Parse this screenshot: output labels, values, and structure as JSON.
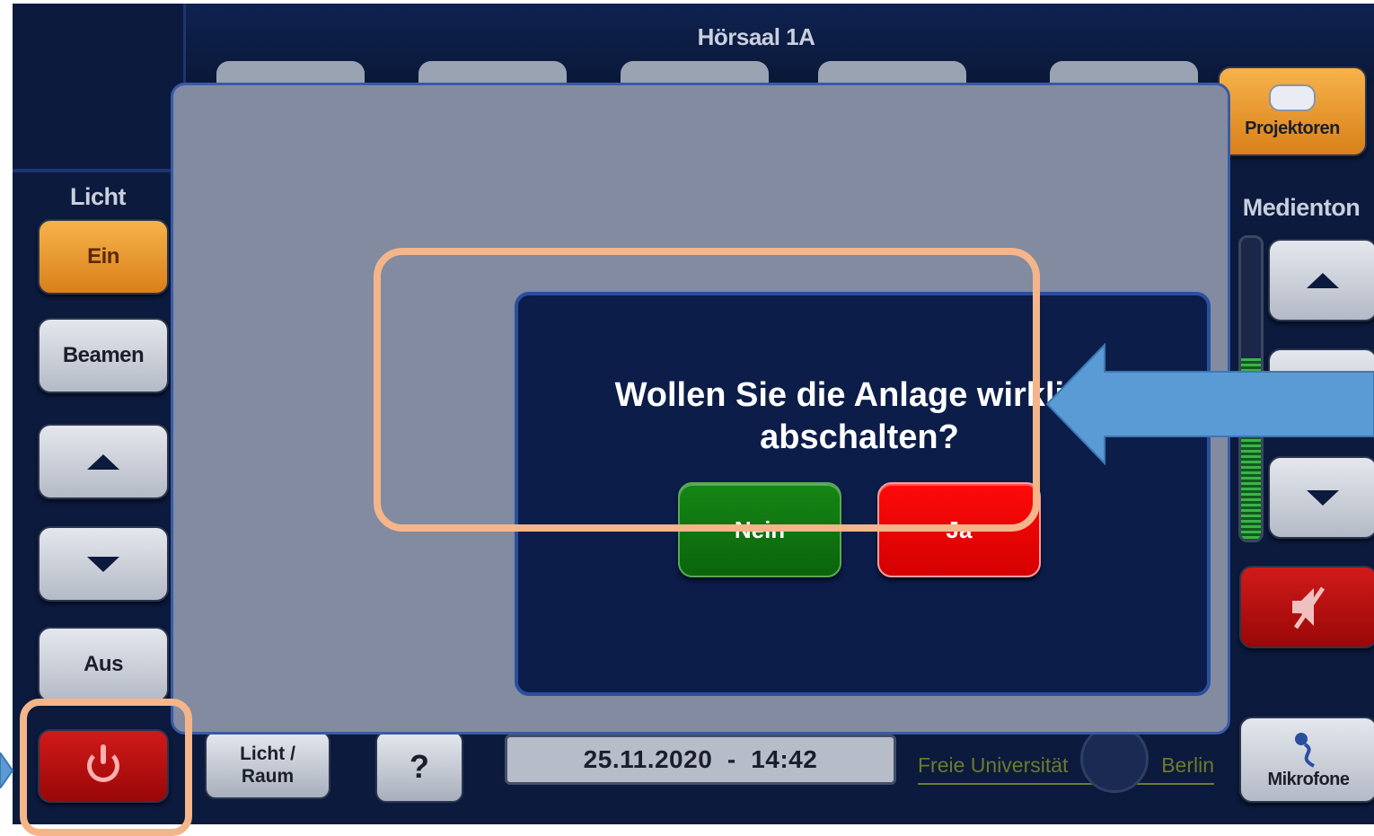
{
  "header": {
    "title": "Hörsaal 1A"
  },
  "right_panel": {
    "projectors_label": "Projektoren",
    "audio_label": "Medienton",
    "microphones_label": "Mikrofone",
    "level": 0.6
  },
  "left_panel": {
    "light_label": "Licht",
    "on_label": "Ein",
    "beamer_label": "Beamen",
    "off_label": "Aus"
  },
  "bottom_bar": {
    "light_room_label": "Licht / Raum",
    "help_label": "?",
    "datetime": "25.11.2020  -  14:42",
    "brand_left": "Freie Universität",
    "brand_right": "Berlin"
  },
  "dialog": {
    "question": "Wollen Sie die Anlage wirklich abschalten?",
    "no_label": "Nein",
    "yes_label": "Ja"
  },
  "annotation": {
    "highlight_color": "#f4b58a",
    "arrow_color": "#5b9bd5"
  }
}
